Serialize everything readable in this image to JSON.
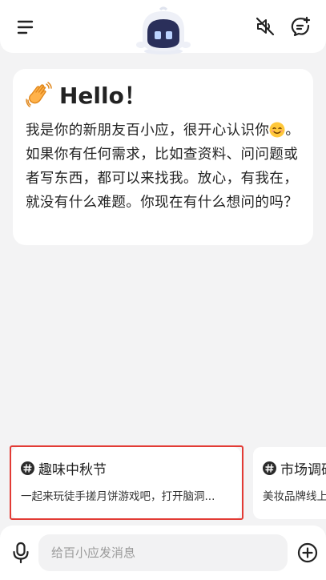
{
  "header": {
    "icons": [
      "menu-icon",
      "bot-avatar",
      "mute-icon",
      "new-chat-icon"
    ]
  },
  "greeting": {
    "title": "Hello！",
    "text_part1": "我是你的新朋友百小应，很开心认识你",
    "text_part2": "。如果你有任何需求，比如查资料、问问题或者写东西，都可以来找我。放心，有我在，就没有什么难题。你现在有什么想问的吗？"
  },
  "suggestions": [
    {
      "title": "趣味中秋节",
      "desc": "一起来玩徒手搓月饼游戏吧，打开脑洞..."
    },
    {
      "title": "市场调研",
      "desc": "美妆品牌线上"
    }
  ],
  "composer": {
    "placeholder": "给百小应发消息"
  },
  "colors": {
    "background": "#f3f3f4",
    "card": "#ffffff",
    "highlight": "#e23b35",
    "bot_body": "#2a2f5a"
  }
}
